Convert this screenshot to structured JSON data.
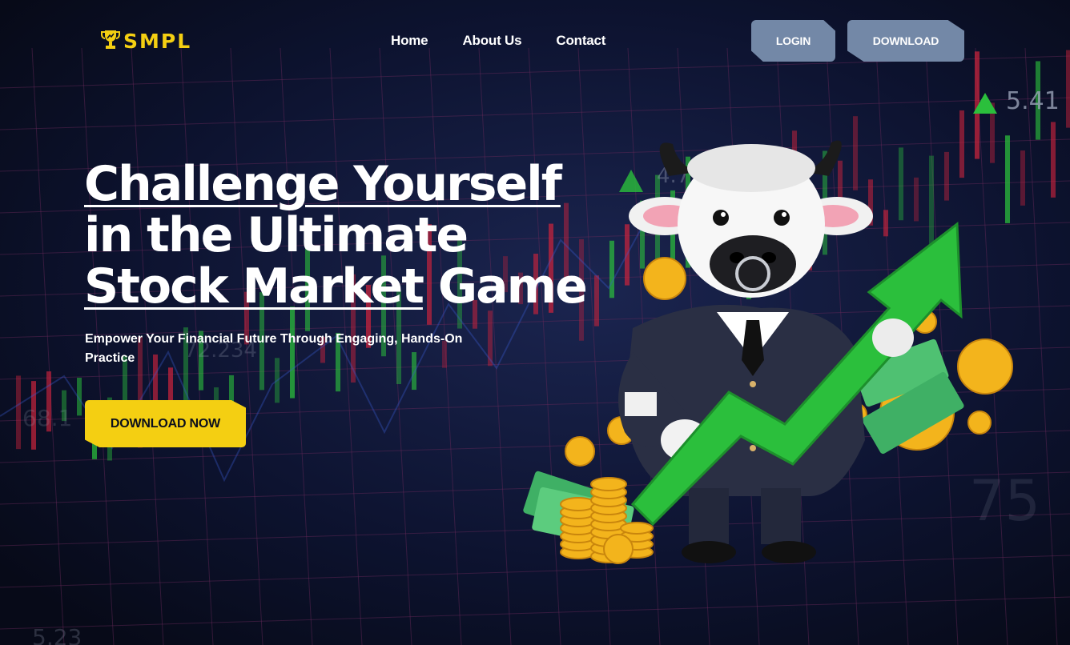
{
  "header": {
    "logo_text": "SMPL",
    "nav": [
      {
        "label": "Home"
      },
      {
        "label": "About Us"
      },
      {
        "label": "Contact"
      }
    ],
    "login_label": "LOGIN",
    "download_label": "DOWNLOAD"
  },
  "hero": {
    "title_line1": "Challenge Yourself",
    "title_line2": "in the Ultimate",
    "title_line3_underlined": "Stock Market",
    "title_line3_rest": " Game",
    "subtitle": "Empower Your Financial Future Through Engaging, Hands-On Practice",
    "cta_label": "DOWNLOAD NOW"
  },
  "colors": {
    "background": "#0b1022",
    "brand_yellow": "#f4cf12",
    "header_button": "#7388a7",
    "chart_green": "#2bbf3c",
    "chart_red": "#c9233c"
  },
  "background_numbers": [
    "5.41",
    "4.72",
    "72.234",
    "68.1",
    "5.23",
    "75"
  ]
}
